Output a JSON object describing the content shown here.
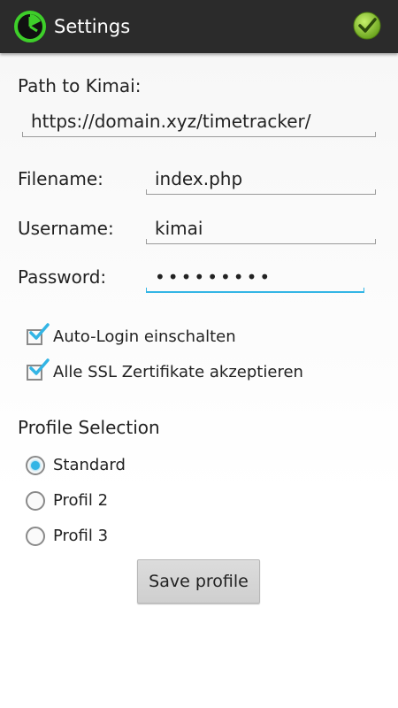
{
  "action_bar": {
    "title": "Settings",
    "app_icon": "clock-icon",
    "save_icon": "check-circle-icon",
    "background": "#2b2b2b",
    "accent": "#8bc34a"
  },
  "form": {
    "path_label": "Path to Kimai:",
    "path_value": "https://domain.xyz/timetracker/",
    "filename_label": "Filename:",
    "filename_value": "index.php",
    "username_label": "Username:",
    "username_value": "kimai",
    "password_label": "Password:",
    "password_value": "•••••••••",
    "focus_color": "#33b5e5"
  },
  "options": {
    "auto_login": {
      "label": "Auto-Login einschalten",
      "checked": true
    },
    "accept_ssl": {
      "label": "Alle SSL Zertifikate akzeptieren",
      "checked": true
    }
  },
  "profiles": {
    "heading": "Profile Selection",
    "items": [
      {
        "label": "Standard",
        "selected": true
      },
      {
        "label": "Profil 2",
        "selected": false
      },
      {
        "label": "Profil 3",
        "selected": false
      }
    ],
    "save_label": "Save profile"
  }
}
